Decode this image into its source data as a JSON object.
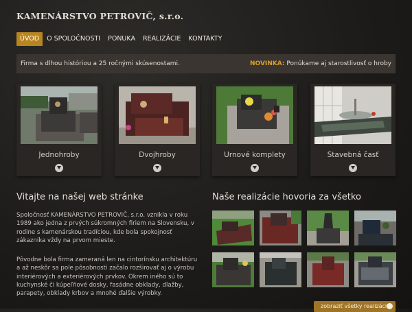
{
  "header": {
    "title": "KAMENÁRSTVO PETROVIČ, s.r.o."
  },
  "nav": {
    "items": [
      {
        "label": "ÚVOD",
        "active": true
      },
      {
        "label": "O SPOLOČNOSTI"
      },
      {
        "label": "PONUKA"
      },
      {
        "label": "REALIZÁCIE"
      },
      {
        "label": "KONTAKTY"
      }
    ]
  },
  "info_bar": {
    "left_text": "Firma s dlhou históriou a 25 ročnými skúsenostami.",
    "novinka_label": "NOVINKA:",
    "right_text": "Ponúkame aj starostlivosť o hroby"
  },
  "categories": [
    {
      "label": "Jednohroby",
      "icon": "chevron-circle-down-icon"
    },
    {
      "label": "Dvojhroby",
      "icon": "chevron-circle-down-icon"
    },
    {
      "label": "Urnové komplety",
      "icon": "chevron-circle-down-icon"
    },
    {
      "label": "Stavebná časť",
      "icon": "chevron-circle-down-icon"
    }
  ],
  "welcome": {
    "heading": "Vitajte na našej web stránke",
    "paragraph1": "Spoločnosť KAMENÁRSTVO PETROVIČ, s.r.o. vznikla v roku 1989 ako jedna z prvých súkromných firiem na Slovensku, v rodine s kamenárskou tradíciou, kde bola spokojnosť zákazníka vždy na prvom mieste.",
    "paragraph2": "Pôvodne bola firma zameraná len na cintorínsku architektúru a až neskôr sa pole pôsobnosti začalo rozširovať aj o výrobu interiérových a exteriérových prvkov. Okrem iného sú to kuchynské či kúpeľňové dosky, fasádne obklady, dlažby, parapety, obklady krbov a mnohé ďalšie výrobky."
  },
  "gallery": {
    "heading": "Naše realizácie hovoria za všetko",
    "button_label": "zobraziť všetky realizácie",
    "button_icon": "chevron-circle-right-icon"
  },
  "colors": {
    "accent": "#b8851f",
    "novinka": "#d9a02a",
    "info_bar_bg": "#3b3531",
    "card_bg": "#292624"
  }
}
